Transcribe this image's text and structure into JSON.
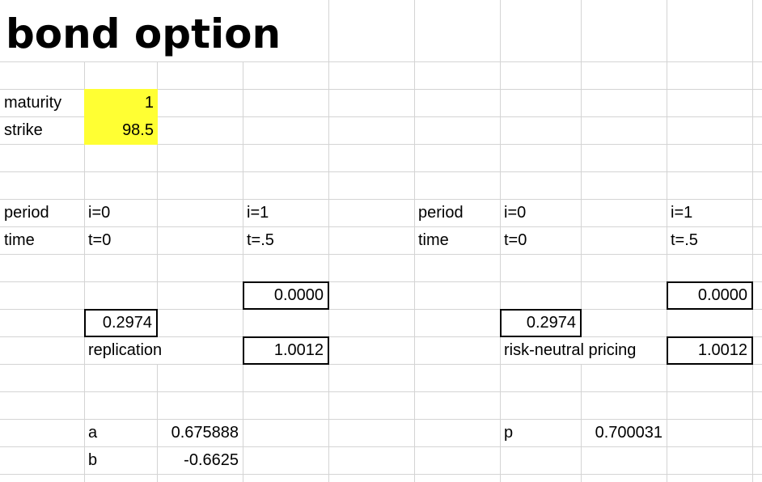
{
  "title": "bond option",
  "colors": {
    "input_fill": "#ffff33",
    "gridline": "#d4d4d4"
  },
  "inputs": [
    {
      "label": "maturity",
      "value": "1"
    },
    {
      "label": "strike",
      "value": "98.5"
    }
  ],
  "replication": {
    "period_label": "period",
    "periods": [
      "i=0",
      "i=1"
    ],
    "time_label": "time",
    "times": [
      "t=0",
      "t=.5"
    ],
    "up_node": "0.0000",
    "root_node": "0.2974",
    "down_node": "1.0012",
    "method_label": "replication",
    "params": [
      {
        "name": "a",
        "value": "0.675888"
      },
      {
        "name": "b",
        "value": "-0.6625"
      }
    ]
  },
  "risk_neutral": {
    "period_label": "period",
    "periods": [
      "i=0",
      "i=1"
    ],
    "time_label": "time",
    "times": [
      "t=0",
      "t=.5"
    ],
    "up_node": "0.0000",
    "root_node": "0.2974",
    "down_node": "1.0012",
    "method_label": "risk-neutral pricing",
    "params": [
      {
        "name": "p",
        "value": "0.700031"
      }
    ]
  }
}
